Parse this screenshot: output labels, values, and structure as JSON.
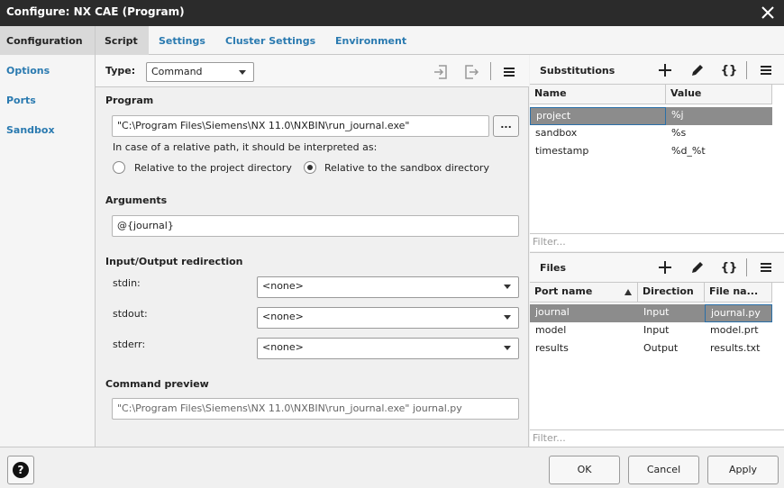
{
  "window": {
    "title": "Configure: NX CAE (Program)"
  },
  "nav": {
    "items": [
      {
        "label": "Configuration"
      },
      {
        "label": "Options"
      },
      {
        "label": "Ports"
      },
      {
        "label": "Sandbox"
      }
    ]
  },
  "tabs": [
    {
      "label": "Script"
    },
    {
      "label": "Settings"
    },
    {
      "label": "Cluster Settings"
    },
    {
      "label": "Environment"
    }
  ],
  "script": {
    "type_label": "Type:",
    "type_value": "Command",
    "program_heading": "Program",
    "program_path": "\"C:\\Program Files\\Siemens\\NX 11.0\\NXBIN\\run_journal.exe\"",
    "browse_label": "...",
    "relative_hint": "In case of a relative path, it should be interpreted as:",
    "radio_project": "Relative to the project directory",
    "radio_sandbox": "Relative to the sandbox directory",
    "arguments_heading": "Arguments",
    "arguments_value": "@{journal}",
    "io_heading": "Input/Output redirection",
    "stdin_label": "stdin:",
    "stdin_value": "<none>",
    "stdout_label": "stdout:",
    "stdout_value": "<none>",
    "stderr_label": "stderr:",
    "stderr_value": "<none>",
    "preview_heading": "Command preview",
    "preview_value": "\"C:\\Program Files\\Siemens\\NX 11.0\\NXBIN\\run_journal.exe\" journal.py"
  },
  "substitutions": {
    "title": "Substitutions",
    "braces_label": "{}",
    "columns": [
      "Name",
      "Value"
    ],
    "rows": [
      {
        "name": "project",
        "value": "%j"
      },
      {
        "name": "sandbox",
        "value": "%s"
      },
      {
        "name": "timestamp",
        "value": "%d_%t"
      }
    ],
    "filter_placeholder": "Filter..."
  },
  "files": {
    "title": "Files",
    "braces_label": "{}",
    "columns": [
      "Port name",
      "Direction",
      "File na..."
    ],
    "rows": [
      {
        "port": "journal",
        "direction": "Input",
        "file": "journal.py"
      },
      {
        "port": "model",
        "direction": "Input",
        "file": "model.prt"
      },
      {
        "port": "results",
        "direction": "Output",
        "file": "results.txt"
      }
    ],
    "filter_placeholder": "Filter..."
  },
  "footer": {
    "help_label": "?",
    "ok_label": "OK",
    "cancel_label": "Cancel",
    "apply_label": "Apply"
  }
}
